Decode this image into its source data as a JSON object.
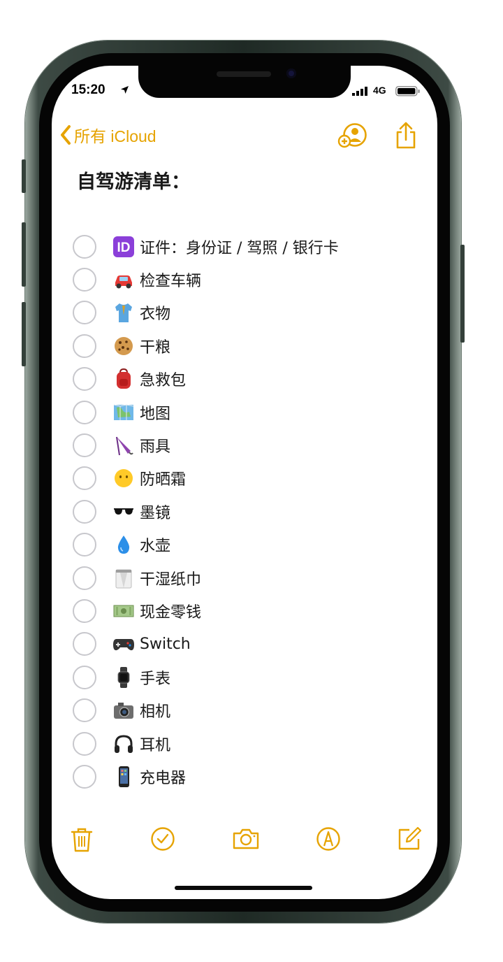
{
  "status_bar": {
    "time": "15:20",
    "network": "4G"
  },
  "nav": {
    "back_label": "所有 iCloud"
  },
  "note": {
    "title": "自驾游清单：",
    "items": [
      {
        "emoji": "id-emoji",
        "label": "证件：身份证 / 驾照 / 银行卡",
        "checked": false
      },
      {
        "emoji": "car-emoji",
        "label": "检查车辆",
        "checked": false
      },
      {
        "emoji": "shirt-emoji",
        "label": "衣物",
        "checked": false
      },
      {
        "emoji": "cookie-emoji",
        "label": "干粮",
        "checked": false
      },
      {
        "emoji": "backpack-emoji",
        "label": "急救包",
        "checked": false
      },
      {
        "emoji": "map-emoji",
        "label": "地图",
        "checked": false
      },
      {
        "emoji": "umbrella-emoji",
        "label": "雨具",
        "checked": false
      },
      {
        "emoji": "face-emoji",
        "label": "防晒霜",
        "checked": false
      },
      {
        "emoji": "sunglasses-emoji",
        "label": "墨镜",
        "checked": false
      },
      {
        "emoji": "droplet-emoji",
        "label": "水壶",
        "checked": false
      },
      {
        "emoji": "tissue-emoji",
        "label": "干湿纸巾",
        "checked": false
      },
      {
        "emoji": "money-emoji",
        "label": "现金零钱",
        "checked": false
      },
      {
        "emoji": "gamepad-emoji",
        "label": "Switch",
        "checked": false
      },
      {
        "emoji": "watch-emoji",
        "label": "手表",
        "checked": false
      },
      {
        "emoji": "camera-emoji",
        "label": "相机",
        "checked": false
      },
      {
        "emoji": "headphones-emoji",
        "label": "耳机",
        "checked": false
      },
      {
        "emoji": "phone-emoji",
        "label": "充电器",
        "checked": false
      }
    ]
  },
  "colors": {
    "accent": "#e6a300",
    "text": "#1a1a1a",
    "checkbox": "#c7c7cc"
  }
}
